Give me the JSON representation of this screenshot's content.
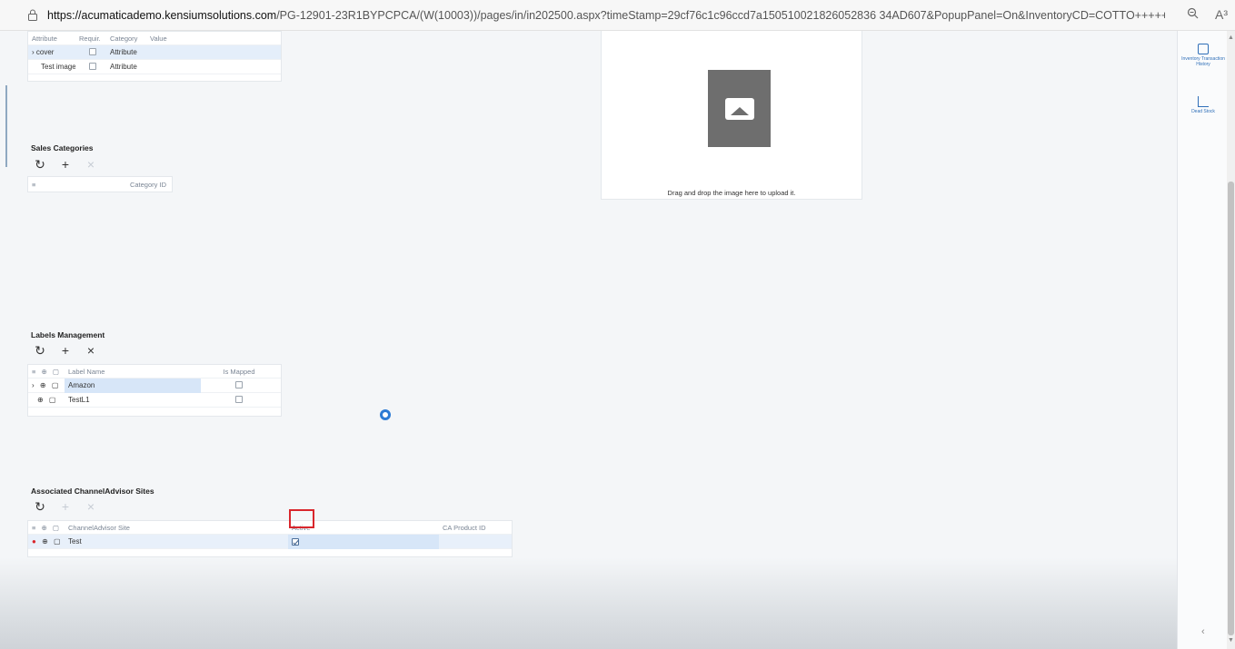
{
  "browser": {
    "url_host": "https://acumaticademo.kensiumsolutions.com",
    "url_path": "/PG-12901-23R1BYPCPCA/(W(10003))/pages/in/in202500.aspx?timeStamp=29cf76c1c96ccd7a150510021826052836 34AD607&PopupPanel=On&InventoryCD=COTTO+++++",
    "zoom_icon": "zoom-icon",
    "read_aloud_label": "A³"
  },
  "attributes_grid": {
    "headers": [
      "Attribute",
      "Requir.",
      "Category",
      "Value"
    ],
    "rows": [
      {
        "attribute": "cover",
        "category": "Attribute",
        "selected": true
      },
      {
        "attribute": "Test image f...",
        "category": "Attribute",
        "selected": false
      }
    ]
  },
  "sales_categories": {
    "title": "Sales Categories",
    "header": "Category ID"
  },
  "image_upload": {
    "caption": "Drag and drop the image here to upload it."
  },
  "labels_management": {
    "title": "Labels Management",
    "headers": [
      "Label Name",
      "Is Mapped"
    ],
    "rows": [
      {
        "label": "Amazon",
        "mapped": false,
        "selected": true
      },
      {
        "label": "TestL1",
        "mapped": false,
        "selected": false
      }
    ]
  },
  "channel_advisor": {
    "title": "Associated ChannelAdvisor Sites",
    "headers": [
      "ChannelAdvisor Site",
      "Active",
      "CA Product ID"
    ],
    "rows": [
      {
        "site": "Test",
        "active": true,
        "ca_product_id": ""
      }
    ]
  },
  "side_panel": {
    "items": [
      {
        "label": "Inventory Transaction History",
        "icon": "history-icon"
      },
      {
        "label": "Dead Stock",
        "icon": "chart-icon"
      }
    ]
  },
  "colors": {
    "accent": "#2f6fb8",
    "highlight_box": "#d9262c",
    "selection": "#e4eefa"
  }
}
